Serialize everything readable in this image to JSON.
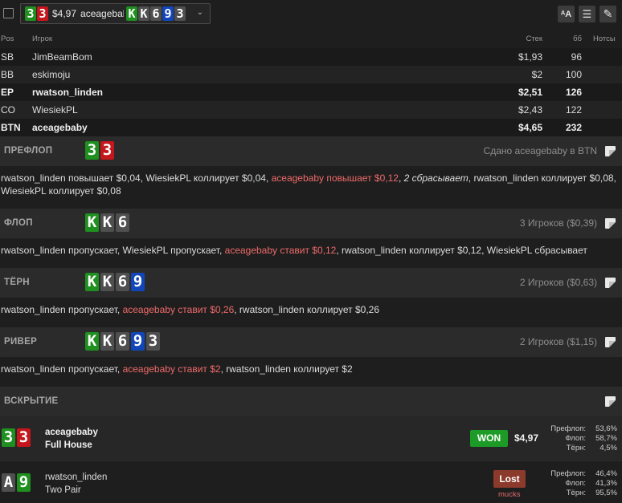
{
  "top": {
    "hand_cards": [
      {
        "r": "3",
        "c": "green"
      },
      {
        "r": "3",
        "c": "red"
      }
    ],
    "amount": "$4,97",
    "user": "aceagebaby",
    "board": [
      {
        "r": "K",
        "c": "green"
      },
      {
        "r": "K",
        "c": "gray"
      },
      {
        "r": "6",
        "c": "gray"
      },
      {
        "r": "9",
        "c": "blue"
      },
      {
        "r": "3",
        "c": "gray"
      }
    ],
    "chevron": "⌄",
    "buttons": [
      {
        "name": "font-size-icon",
        "glyph": "ᴬA"
      },
      {
        "name": "list-icon",
        "glyph": "☰"
      },
      {
        "name": "edit-pencil-icon",
        "glyph": "✎"
      }
    ]
  },
  "players": {
    "headers": {
      "pos": "Pos",
      "name": "Игрок",
      "stack": "Стек",
      "bb": "бб",
      "notes": "Нотсы"
    },
    "rows": [
      {
        "pos": "SB",
        "name": "JimBeamBom",
        "stack": "$1,93",
        "bb": "96",
        "bold": false
      },
      {
        "pos": "BB",
        "name": "eskimoju",
        "stack": "$2",
        "bb": "100",
        "bold": false
      },
      {
        "pos": "EP",
        "name": "rwatson_linden",
        "stack": "$2,51",
        "bb": "126",
        "bold": true
      },
      {
        "pos": "CO",
        "name": "WiesiekPL",
        "stack": "$2,43",
        "bb": "122",
        "bold": false
      },
      {
        "pos": "BTN",
        "name": "aceagebaby",
        "stack": "$4,65",
        "bb": "232",
        "bold": true
      }
    ]
  },
  "streets": [
    {
      "title": "ПРЕФЛОП",
      "cards": [
        {
          "r": "3",
          "c": "green"
        },
        {
          "r": "3",
          "c": "red"
        }
      ],
      "right": "Сдано aceagebaby в BTN",
      "actions": [
        {
          "t": "rwatson_linden повышает $0,04, WiesiekPL коллирует $0,04, ",
          "s": ""
        },
        {
          "t": "aceagebaby повышает $0,12",
          "s": "hero"
        },
        {
          "t": ", ",
          "s": ""
        },
        {
          "t": "2 сбрасывает",
          "s": "folds"
        },
        {
          "t": ", rwatson_linden коллирует $0,08, WiesiekPL коллирует $0,08",
          "s": ""
        }
      ]
    },
    {
      "title": "ФЛОП",
      "cards": [
        {
          "r": "K",
          "c": "green"
        },
        {
          "r": "K",
          "c": "gray"
        },
        {
          "r": "6",
          "c": "gray"
        }
      ],
      "right": "3 Игроков ($0,39)",
      "actions": [
        {
          "t": "rwatson_linden пропускает, WiesiekPL пропускает, ",
          "s": ""
        },
        {
          "t": "aceagebaby ставит $0,12",
          "s": "hero"
        },
        {
          "t": ", rwatson_linden коллирует $0,12, WiesiekPL сбрасывает",
          "s": ""
        }
      ]
    },
    {
      "title": "ТЁРН",
      "cards": [
        {
          "r": "K",
          "c": "green"
        },
        {
          "r": "K",
          "c": "gray"
        },
        {
          "r": "6",
          "c": "gray"
        },
        {
          "r": "9",
          "c": "blue"
        }
      ],
      "right": "2 Игроков ($0,63)",
      "actions": [
        {
          "t": "rwatson_linden пропускает, ",
          "s": ""
        },
        {
          "t": "aceagebaby ставит $0,26",
          "s": "hero"
        },
        {
          "t": ", rwatson_linden коллирует $0,26",
          "s": ""
        }
      ]
    },
    {
      "title": "РИВЕР",
      "cards": [
        {
          "r": "K",
          "c": "green"
        },
        {
          "r": "K",
          "c": "gray"
        },
        {
          "r": "6",
          "c": "gray"
        },
        {
          "r": "9",
          "c": "blue"
        },
        {
          "r": "3",
          "c": "gray"
        }
      ],
      "right": "2 Игроков ($1,15)",
      "actions": [
        {
          "t": "rwatson_linden пропускает, ",
          "s": ""
        },
        {
          "t": "aceagebaby ставит $2",
          "s": "hero"
        },
        {
          "t": ", rwatson_linden коллирует $2",
          "s": ""
        }
      ]
    },
    {
      "title": "ВСКРЫТИЕ",
      "cards": [],
      "right": "",
      "actions": []
    }
  ],
  "showdown": [
    {
      "cards": [
        {
          "r": "3",
          "c": "green"
        },
        {
          "r": "3",
          "c": "red"
        }
      ],
      "name": "aceagebaby",
      "hand": "Full House",
      "result": "WON",
      "amount": "$4,97",
      "equity": [
        {
          "l": "Префлоп:",
          "v": "53,6%"
        },
        {
          "l": "Флоп:",
          "v": "58,7%"
        },
        {
          "l": "Тёрн:",
          "v": "4,5%"
        }
      ]
    },
    {
      "cards": [
        {
          "r": "A",
          "c": "gray"
        },
        {
          "r": "9",
          "c": "green"
        }
      ],
      "name": "rwatson_linden",
      "hand": "Two Pair",
      "result": "Lost",
      "sub": "mucks",
      "equity": [
        {
          "l": "Префлоп:",
          "v": "46,4%"
        },
        {
          "l": "Флоп:",
          "v": "41,3%"
        },
        {
          "l": "Тёрн:",
          "v": "95,5%"
        }
      ]
    }
  ]
}
